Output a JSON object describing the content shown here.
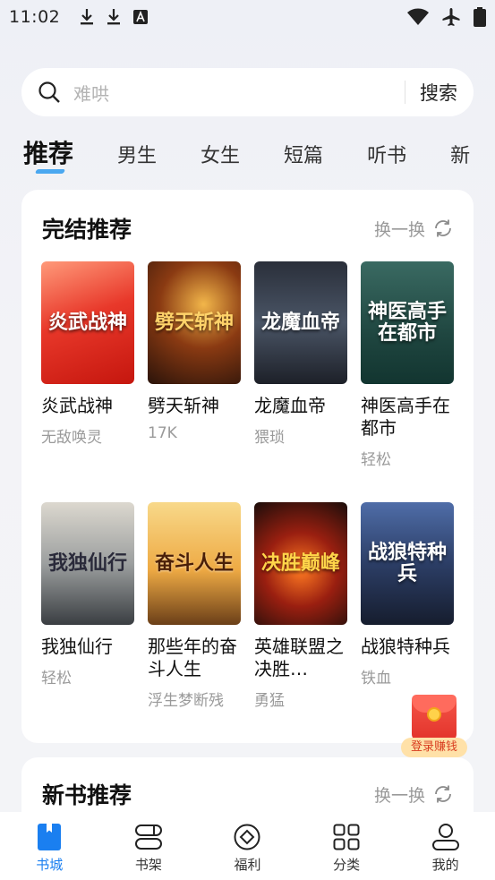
{
  "status_bar": {
    "time": "11:02"
  },
  "search": {
    "placeholder": "难哄",
    "button": "搜索"
  },
  "tabs": [
    "推荐",
    "男生",
    "女生",
    "短篇",
    "听书",
    "新"
  ],
  "finished_section": {
    "title": "完结推荐",
    "refresh_label": "换一换",
    "books": [
      {
        "title": "炎武战神",
        "author": "无敌唤灵",
        "cover_text": "炎武战神"
      },
      {
        "title": "劈天斩神",
        "author": "17K",
        "cover_text": "劈天斩神"
      },
      {
        "title": "龙魔血帝",
        "author": "猥琐",
        "cover_text": "龙魔血帝"
      },
      {
        "title": "神医高手在都市",
        "author": "轻松",
        "cover_text": "神医高手在都市"
      },
      {
        "title": "我独仙行",
        "author": "轻松",
        "cover_text": "我独仙行"
      },
      {
        "title": "那些年的奋斗人生",
        "author": "浮生梦断残",
        "cover_text": "奋斗人生"
      },
      {
        "title": "英雄联盟之决胜…",
        "author": "勇猛",
        "cover_text": "决胜巅峰"
      },
      {
        "title": "战狼特种兵",
        "author": "铁血",
        "cover_text": "战狼特种兵"
      }
    ]
  },
  "new_section": {
    "title": "新书推荐",
    "refresh_label": "换一换"
  },
  "red_packet": {
    "label": "登录赚钱"
  },
  "bottom_nav": [
    {
      "label": "书城",
      "icon": "book-icon",
      "active": true
    },
    {
      "label": "书架",
      "icon": "shelf-icon",
      "active": false
    },
    {
      "label": "福利",
      "icon": "gift-diamond-icon",
      "active": false
    },
    {
      "label": "分类",
      "icon": "grid-icon",
      "active": false
    },
    {
      "label": "我的",
      "icon": "profile-icon",
      "active": false
    }
  ],
  "colors": {
    "accent": "#1a7ff0",
    "tab_indicator": "#4aa8f0",
    "muted": "#9a9a9a"
  }
}
